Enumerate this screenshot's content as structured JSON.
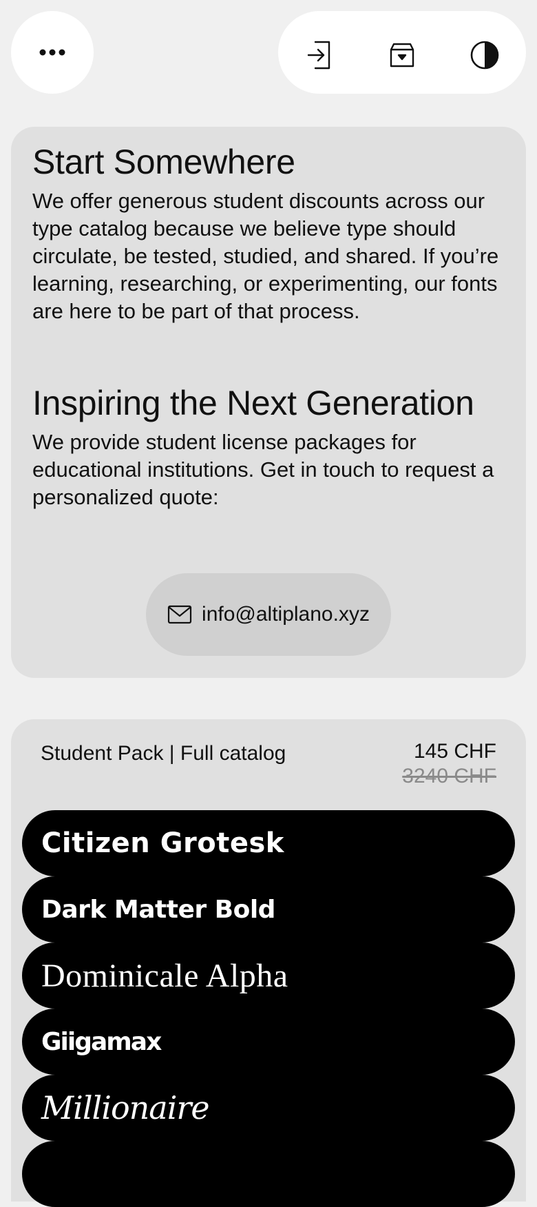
{
  "header": {
    "menu_icon": "more-horizontal-icon",
    "actions": [
      {
        "icon": "login-icon"
      },
      {
        "icon": "cart-icon"
      },
      {
        "icon": "contrast-icon"
      }
    ]
  },
  "intro": {
    "title": "Start Somewhere",
    "body": "We offer generous student discounts across our type catalog because we believe type should circulate, be tested, studied, and shared. If you’re learning, researching, or experimenting, our fonts are here to be part of that process.",
    "subtitle": "Inspiring the Next Generation",
    "body2": "We provide student license packages for educational institutions. Get in touch to request a personalized quote:",
    "email": "info@altiplano.xyz",
    "email_icon": "mail-icon"
  },
  "pack": {
    "title": "Student Pack | Full catalog",
    "price": "145 CHF",
    "old_price": "3240 CHF",
    "fonts": [
      {
        "name": "Citizen Grotesk"
      },
      {
        "name": "Dark Matter Bold"
      },
      {
        "name": "Dominicale Alpha"
      },
      {
        "name": "Giigamax"
      },
      {
        "name": "Millionaire"
      },
      {
        "name": ""
      }
    ]
  },
  "colors": {
    "background": "#f0f0f0",
    "card": "#e0e0e0",
    "pill": "#ffffff",
    "email_button": "#d0d0d0",
    "font_row": "#000000"
  }
}
